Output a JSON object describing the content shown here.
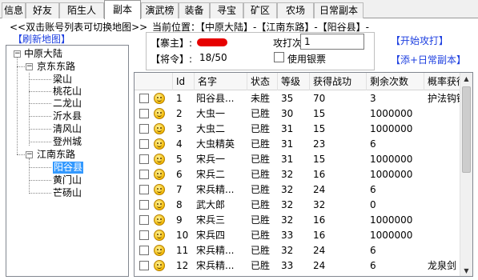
{
  "tabs": [
    "信息",
    "好友",
    "陌生人",
    "副本",
    "演武榜",
    "装备",
    "寻宝",
    "矿区",
    "农场",
    "日常副本"
  ],
  "active_tab": "副本",
  "left": {
    "hint": "<<双击账号列表可切换地图>>",
    "refresh": "【刷新地图】",
    "tree": {
      "root": "中原大陆",
      "groups": [
        {
          "name": "京东东路",
          "items": [
            "梁山",
            "桃花山",
            "二龙山",
            "沂水县",
            "清风山",
            "登州城"
          ]
        },
        {
          "name": "江南东路",
          "items": [
            "阳谷县",
            "黄门山",
            "芒砀山"
          ]
        }
      ],
      "selected": "阳谷县",
      "expander_open": "−"
    }
  },
  "location": {
    "label": "当前位置：",
    "value": "【中原大陆】-【江南东路】-【阳谷县】-"
  },
  "info": {
    "owner_label": "【寨主】:",
    "order_label": "【将令】:",
    "order_value": "18/50",
    "attack_label": "攻打次数：",
    "attack_value": "1",
    "use_silver": "使用银票"
  },
  "buttons": {
    "start_attack": "【开始攻打】",
    "add_daily": "【添+日常副本】"
  },
  "table": {
    "columns": [
      "Id",
      "名字",
      "状态",
      "等级",
      "获得战功",
      "剩余次数",
      "概率获得"
    ],
    "rows": [
      {
        "id": "1",
        "name": "阳谷县...",
        "status": "未胜",
        "level": "35",
        "merit": "70",
        "remain": "3",
        "drop": "护法钩镰"
      },
      {
        "id": "2",
        "name": "大虫一",
        "status": "已胜",
        "level": "30",
        "merit": "15",
        "remain": "1000000",
        "drop": ""
      },
      {
        "id": "3",
        "name": "大虫二",
        "status": "已胜",
        "level": "31",
        "merit": "15",
        "remain": "1000000",
        "drop": ""
      },
      {
        "id": "4",
        "name": "大虫精英",
        "status": "已胜",
        "level": "31",
        "merit": "23",
        "remain": "6",
        "drop": ""
      },
      {
        "id": "5",
        "name": "宋兵一",
        "status": "已胜",
        "level": "31",
        "merit": "15",
        "remain": "1000000",
        "drop": ""
      },
      {
        "id": "6",
        "name": "宋兵二",
        "status": "已胜",
        "level": "32",
        "merit": "16",
        "remain": "1000000",
        "drop": ""
      },
      {
        "id": "7",
        "name": "宋兵精...",
        "status": "已胜",
        "level": "32",
        "merit": "24",
        "remain": "6",
        "drop": ""
      },
      {
        "id": "8",
        "name": "武大郎",
        "status": "已胜",
        "level": "32",
        "merit": "32",
        "remain": "0",
        "drop": ""
      },
      {
        "id": "9",
        "name": "宋兵三",
        "status": "已胜",
        "level": "32",
        "merit": "16",
        "remain": "1000000",
        "drop": ""
      },
      {
        "id": "10",
        "name": "宋兵四",
        "status": "已胜",
        "level": "33",
        "merit": "16",
        "remain": "1000000",
        "drop": ""
      },
      {
        "id": "11",
        "name": "宋兵精...",
        "status": "已胜",
        "level": "32",
        "merit": "24",
        "remain": "6",
        "drop": ""
      },
      {
        "id": "12",
        "name": "宋兵精...",
        "status": "已胜",
        "level": "33",
        "merit": "24",
        "remain": "6",
        "drop": "龙泉剑"
      }
    ]
  },
  "colors": {
    "link_blue": "#1d3fe0",
    "selection": "#3399ff",
    "masked_red": "#e60000"
  }
}
